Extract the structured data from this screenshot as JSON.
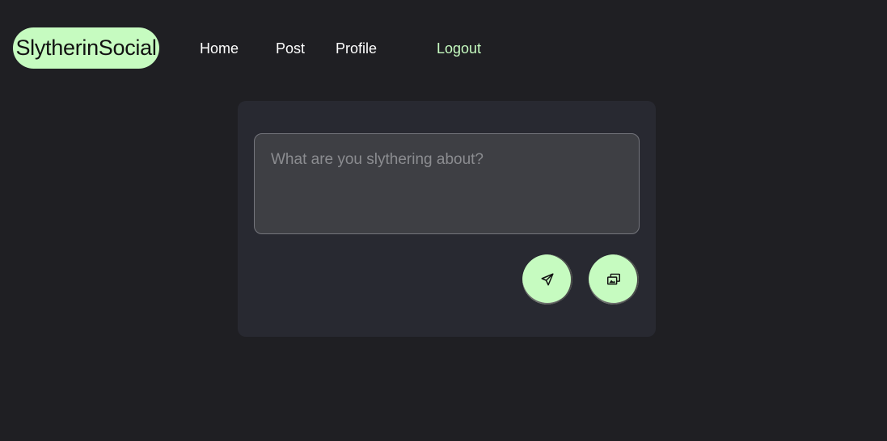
{
  "navbar": {
    "brand": "SlytherinSocial",
    "links": {
      "home": "Home",
      "post": "Post",
      "profile": "Profile",
      "logout": "Logout"
    }
  },
  "composer": {
    "placeholder": "What are you slythering about?",
    "value": "",
    "actions": {
      "send_icon": "paper-plane-icon",
      "media_icon": "images-icon"
    }
  },
  "colors": {
    "background": "#1f1f23",
    "card": "#282931",
    "accent": "#c6fbc0",
    "textarea": "#3e3f44"
  }
}
